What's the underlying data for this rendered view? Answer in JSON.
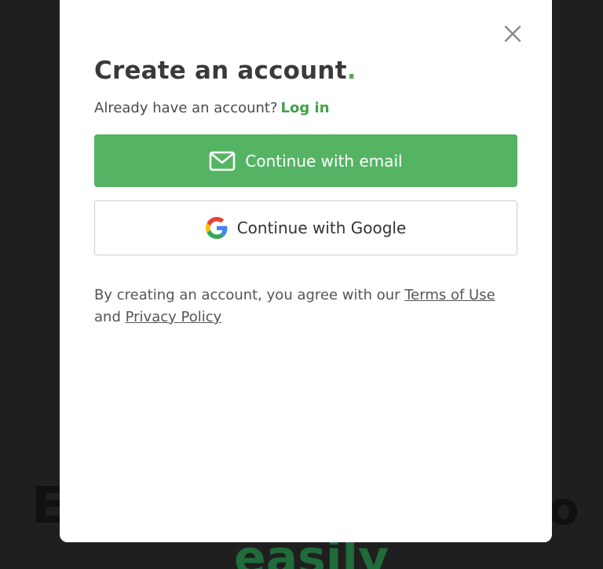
{
  "background": {
    "text_left": "E",
    "text_right": "o",
    "text_bottom": "easily"
  },
  "modal": {
    "close_icon": "close-icon",
    "title": "Create an account",
    "title_dot": ".",
    "subtitle_prefix": "Already have an account?",
    "login_link": "Log in",
    "email_button_label": "Continue with email",
    "email_icon": "mail-icon",
    "google_button_label": "Continue with Google",
    "google_icon": "google-logo-icon",
    "terms_prefix": "By creating an account, you agree with our",
    "terms_link": "Terms of Use",
    "terms_and": "and",
    "privacy_link": "Privacy Policy"
  },
  "colors": {
    "accent": "#55b464",
    "link": "#43a047",
    "overlay": "#1f1f1f"
  }
}
